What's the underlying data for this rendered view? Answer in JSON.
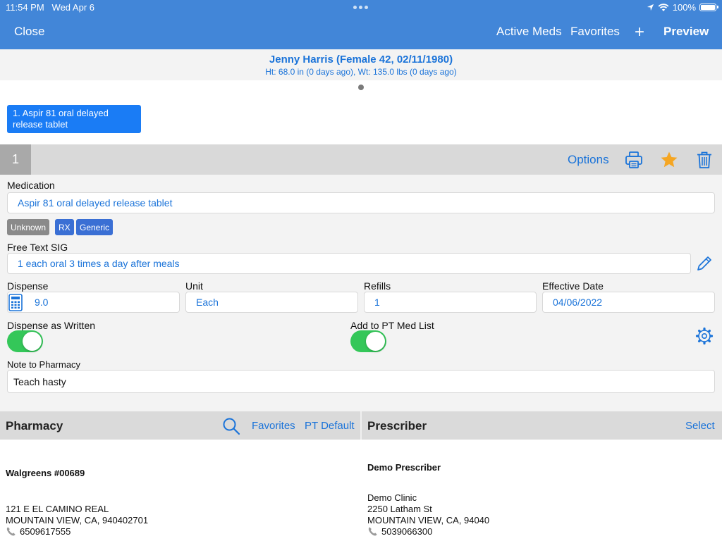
{
  "status": {
    "time": "11:54 PM",
    "date": "Wed Apr 6",
    "battery": "100%"
  },
  "nav": {
    "close": "Close",
    "active_meds": "Active Meds",
    "favorites": "Favorites",
    "add": "+",
    "preview": "Preview"
  },
  "patient": {
    "name": "Jenny Harris (Female 42, 02/11/1980)",
    "vitals": "Ht: 68.0 in (0 days ago), Wt: 135.0 lbs (0 days ago)"
  },
  "med_chip": "1. Aspir 81 oral delayed release tablet",
  "rx": {
    "number": "1",
    "options": "Options",
    "medication_label": "Medication",
    "medication_value": "Aspir 81 oral delayed release tablet",
    "tags": [
      "Unknown",
      "RX",
      "Generic"
    ],
    "sig_label": "Free Text SIG",
    "sig_value": "1 each oral 3 times a day after meals",
    "dispense_label": "Dispense",
    "dispense_value": "9.0",
    "unit_label": "Unit",
    "unit_value": "Each",
    "refills_label": "Refills",
    "refills_value": "1",
    "effective_label": "Effective Date",
    "effective_value": "04/06/2022",
    "daw_label": "Dispense as Written",
    "daw_on": true,
    "pt_med_label": "Add to PT Med List",
    "pt_med_on": true,
    "note_label": "Note to Pharmacy",
    "note_value": "Teach hasty"
  },
  "pharmacy": {
    "title": "Pharmacy",
    "favorites": "Favorites",
    "pt_default": "PT Default",
    "name": "Walgreens #00689",
    "address1": "121 E EL CAMINO REAL",
    "address2": "MOUNTAIN VIEW, CA, 940402701",
    "phone": "6509617555"
  },
  "prescriber": {
    "title": "Prescriber",
    "select": "Select",
    "name": "Demo Prescriber",
    "clinic": "Demo Clinic",
    "address1": "2250 Latham St",
    "address2": "MOUNTAIN VIEW, CA, 94040",
    "phone": "5039066300"
  },
  "colors": {
    "nav": "#4286d8",
    "link": "#1a73d9",
    "chip": "#1a7cf5",
    "toggle_on": "#34c759",
    "star": "#f5a623"
  }
}
